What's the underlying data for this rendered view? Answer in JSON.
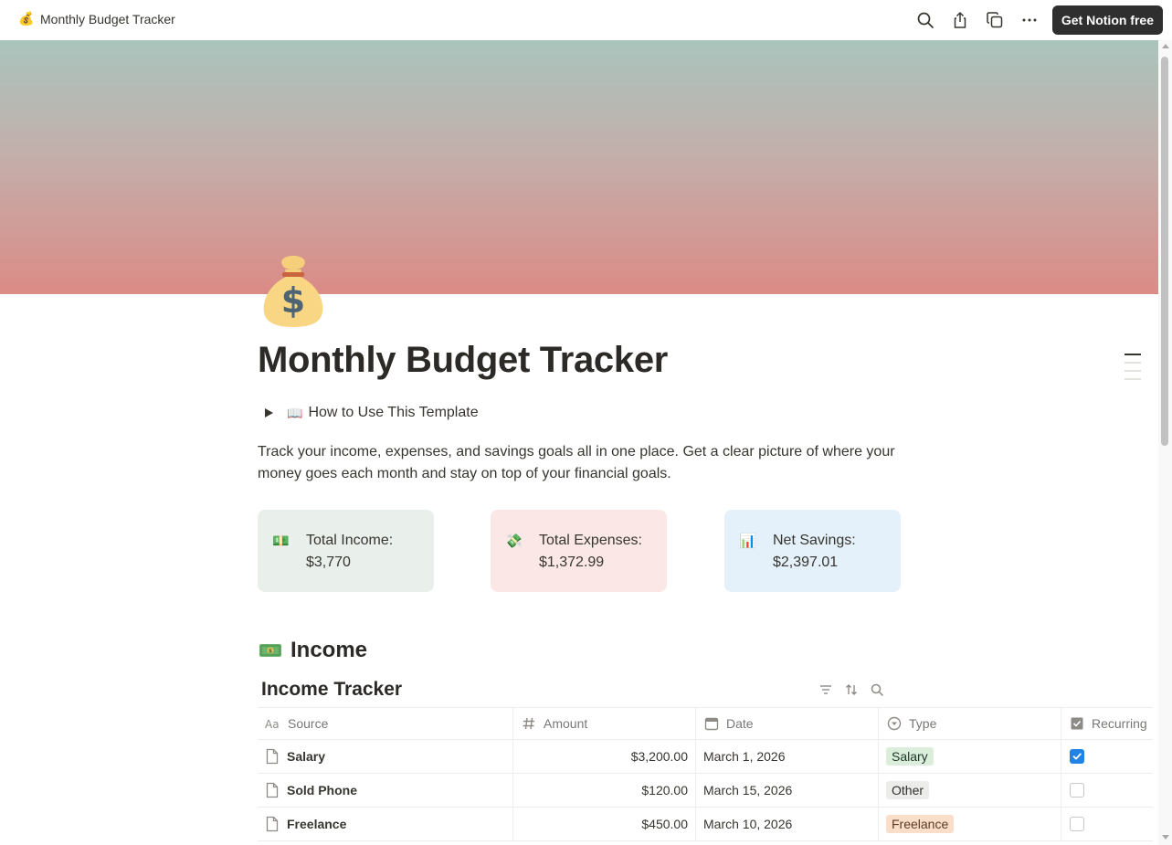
{
  "topbar": {
    "page_emoji": "💰",
    "page_title": "Monthly Budget Tracker",
    "cta_label": "Get Notion free"
  },
  "page": {
    "icon": "money-bag",
    "title": "Monthly Budget Tracker",
    "toggle_label": "How to Use This Template",
    "description": "Track your income, expenses, and savings goals all in one place. Get a clear picture of where your money goes each month and stay on top of your financial goals."
  },
  "callouts": [
    {
      "icon": "💵",
      "label": "Total Income:",
      "value": "$3,770",
      "bg": "#e9f0eb"
    },
    {
      "icon": "💸",
      "label": "Total Expenses:",
      "value": "$1,372.99",
      "bg": "#fbe8e6"
    },
    {
      "icon": "📊",
      "label": "Net Savings:",
      "value": "$2,397.01",
      "bg": "#e4f0fa"
    }
  ],
  "income_section": {
    "heading": "Income",
    "db_title": "Income Tracker",
    "columns": [
      "Source",
      "Amount",
      "Date",
      "Type",
      "Recurring"
    ],
    "rows": [
      {
        "source": "Salary",
        "amount": "$3,200.00",
        "date": "March 1, 2026",
        "type": "Salary",
        "type_bg": "#dbeddb",
        "type_color": "#1c3829",
        "recurring": true
      },
      {
        "source": "Sold Phone",
        "amount": "$120.00",
        "date": "March 15, 2026",
        "type": "Other",
        "type_bg": "#ececea",
        "type_color": "#32302c",
        "recurring": false
      },
      {
        "source": "Freelance",
        "amount": "$450.00",
        "date": "March 10, 2026",
        "type": "Freelance",
        "type_bg": "#fadec9",
        "type_color": "#5c3b23",
        "recurring": false
      }
    ]
  },
  "colors": {
    "accent_blue": "#2383e2",
    "cta_bg": "#2f2f2f"
  }
}
